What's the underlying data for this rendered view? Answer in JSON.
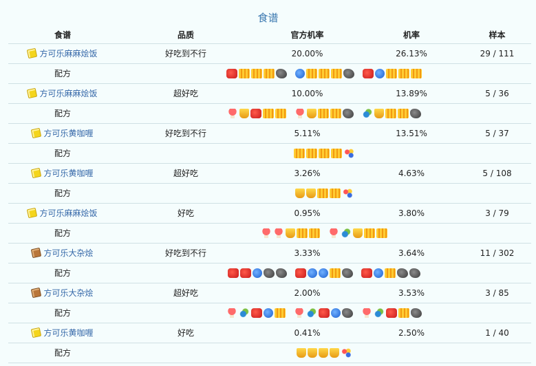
{
  "caption": "食谱",
  "columns": {
    "recipe": "食谱",
    "quality": "品质",
    "official_rate": "官方机率",
    "rate": "机率",
    "sample": "样本"
  },
  "recipe_label": "配方",
  "rows": [
    {
      "name": "方可乐麻麻烩饭",
      "icon": "gold",
      "quality": "好吃到不行",
      "official_rate": "20.00%",
      "rate": "26.13%",
      "sample": "29 / 111",
      "recipes": [
        [
          "meat",
          "grain",
          "grain",
          "grain",
          "rock"
        ],
        [
          "fish",
          "grain",
          "grain",
          "grain",
          "rock"
        ],
        [
          "meat",
          "fish",
          "grain",
          "grain",
          "grain"
        ]
      ]
    },
    {
      "name": "方可乐麻麻烩饭",
      "icon": "gold",
      "quality": "超好吃",
      "official_rate": "10.00%",
      "rate": "13.89%",
      "sample": "5 / 36",
      "recipes": [
        [
          "mush",
          "cup",
          "meat",
          "grain",
          "grain"
        ],
        [
          "mush",
          "cup",
          "grain",
          "grain",
          "rock"
        ],
        [
          "shell",
          "cup",
          "grain",
          "grain",
          "rock"
        ]
      ]
    },
    {
      "name": "方可乐黄咖喱",
      "icon": "gold",
      "quality": "好吃到不行",
      "official_rate": "5.11%",
      "rate": "13.51%",
      "sample": "5 / 37",
      "recipes": [
        [
          "grain",
          "grain",
          "grain",
          "grain",
          "berry"
        ]
      ]
    },
    {
      "name": "方可乐黄咖喱",
      "icon": "gold",
      "quality": "超好吃",
      "official_rate": "3.26%",
      "rate": "4.63%",
      "sample": "5 / 108",
      "recipes": [
        [
          "cup",
          "cup",
          "grain",
          "grain",
          "berry"
        ]
      ]
    },
    {
      "name": "方可乐麻麻烩饭",
      "icon": "gold",
      "quality": "好吃",
      "official_rate": "0.95%",
      "rate": "3.80%",
      "sample": "3 / 79",
      "recipes": [
        [
          "mush",
          "mush",
          "cup",
          "grain",
          "grain"
        ],
        [
          "mush",
          "shell",
          "cup",
          "grain",
          "grain"
        ]
      ]
    },
    {
      "name": "方可乐大杂烩",
      "icon": "brown",
      "quality": "好吃到不行",
      "official_rate": "3.33%",
      "rate": "3.64%",
      "sample": "11 / 302",
      "recipes": [
        [
          "meat",
          "meat",
          "fish",
          "rock",
          "rock"
        ],
        [
          "meat",
          "fish",
          "fish",
          "grain",
          "rock"
        ],
        [
          "meat",
          "fish",
          "grain",
          "rock",
          "rock"
        ]
      ]
    },
    {
      "name": "方可乐大杂烩",
      "icon": "brown",
      "quality": "超好吃",
      "official_rate": "2.00%",
      "rate": "3.53%",
      "sample": "3 / 85",
      "recipes": [
        [
          "mush",
          "shell",
          "meat",
          "fish",
          "grain"
        ],
        [
          "mush",
          "shell",
          "meat",
          "fish",
          "rock"
        ],
        [
          "mush",
          "shell",
          "meat",
          "grain",
          "rock"
        ]
      ]
    },
    {
      "name": "方可乐黄咖喱",
      "icon": "gold",
      "quality": "好吃",
      "official_rate": "0.41%",
      "rate": "2.50%",
      "sample": "1 / 40",
      "recipes": [
        [
          "cup",
          "cup",
          "cup",
          "cup",
          "berry"
        ]
      ]
    }
  ],
  "ingredient_icons": {
    "meat": "meat-icon",
    "fish": "fish-icon",
    "grain": "grain-icon",
    "rock": "rock-icon",
    "mush": "mushroom-icon",
    "cup": "honey-cup-icon",
    "berry": "berries-icon",
    "shell": "shell-icon"
  }
}
